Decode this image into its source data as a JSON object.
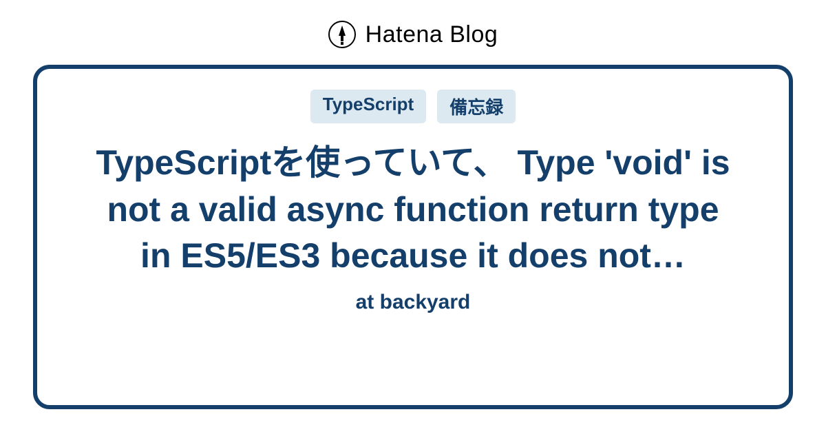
{
  "header": {
    "logo_text": "Hatena Blog"
  },
  "card": {
    "tags": [
      "TypeScript",
      "備忘録"
    ],
    "title": "TypeScriptを使っていて、 Type 'void' is not a valid async function return type in ES5/ES3 because it does not…",
    "subtitle": "at backyard"
  },
  "colors": {
    "primary": "#143f6b",
    "tag_bg": "#dce9f0"
  }
}
